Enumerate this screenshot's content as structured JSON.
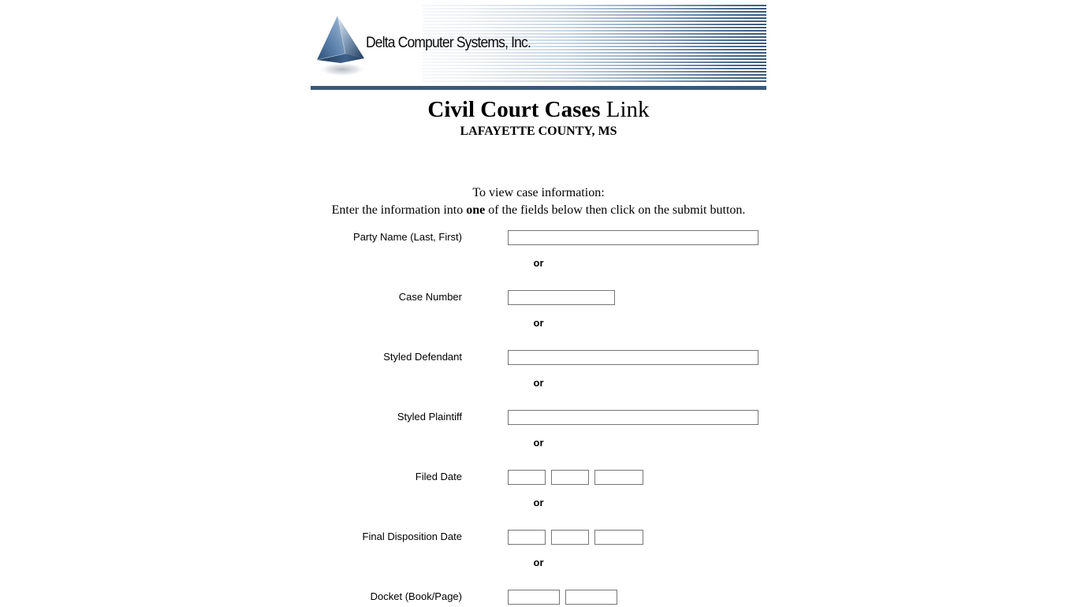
{
  "branding": {
    "company_name": "Delta Computer Systems, Inc.",
    "logo_icon": "triangle-pyramid-logo",
    "banner_accent_color": "#3c5876",
    "banner_light_color": "#ffffff"
  },
  "header": {
    "title_bold": "Civil Court Cases",
    "title_light": " Link",
    "subtitle": "LAFAYETTE COUNTY, MS"
  },
  "instructions": {
    "line1": "To view case information:",
    "line2_before": "Enter the information into ",
    "line2_bold": "one",
    "line2_after": " of the fields below then click on the submit button."
  },
  "separator": {
    "label": "or"
  },
  "form": {
    "fields": [
      {
        "name": "party-name",
        "label": "Party Name (Last, First)",
        "inputs": [
          {
            "value": "",
            "placeholder": "",
            "width": "w-wide"
          }
        ]
      },
      {
        "name": "case-number",
        "label": "Case Number",
        "inputs": [
          {
            "value": "",
            "placeholder": "",
            "width": "w-mid"
          }
        ]
      },
      {
        "name": "styled-defendant",
        "label": "Styled Defendant",
        "inputs": [
          {
            "value": "",
            "placeholder": "",
            "width": "w-wide"
          }
        ]
      },
      {
        "name": "styled-plaintiff",
        "label": "Styled Plaintiff",
        "inputs": [
          {
            "value": "",
            "placeholder": "",
            "width": "w-wide"
          }
        ]
      },
      {
        "name": "filed-date",
        "label": "Filed Date",
        "inputs": [
          {
            "value": "",
            "placeholder": "",
            "width": "w-small"
          },
          {
            "value": "",
            "placeholder": "",
            "width": "w-small"
          },
          {
            "value": "",
            "placeholder": "",
            "width": "w-year"
          }
        ]
      },
      {
        "name": "final-disposition-date",
        "label": "Final Disposition Date",
        "inputs": [
          {
            "value": "",
            "placeholder": "",
            "width": "w-small"
          },
          {
            "value": "",
            "placeholder": "",
            "width": "w-small"
          },
          {
            "value": "",
            "placeholder": "",
            "width": "w-year"
          }
        ]
      },
      {
        "name": "docket-book-page",
        "label": "Docket (Book/Page)",
        "inputs": [
          {
            "value": "",
            "placeholder": "",
            "width": "w-dock"
          },
          {
            "value": "",
            "placeholder": "",
            "width": "w-dock"
          }
        ]
      }
    ]
  }
}
